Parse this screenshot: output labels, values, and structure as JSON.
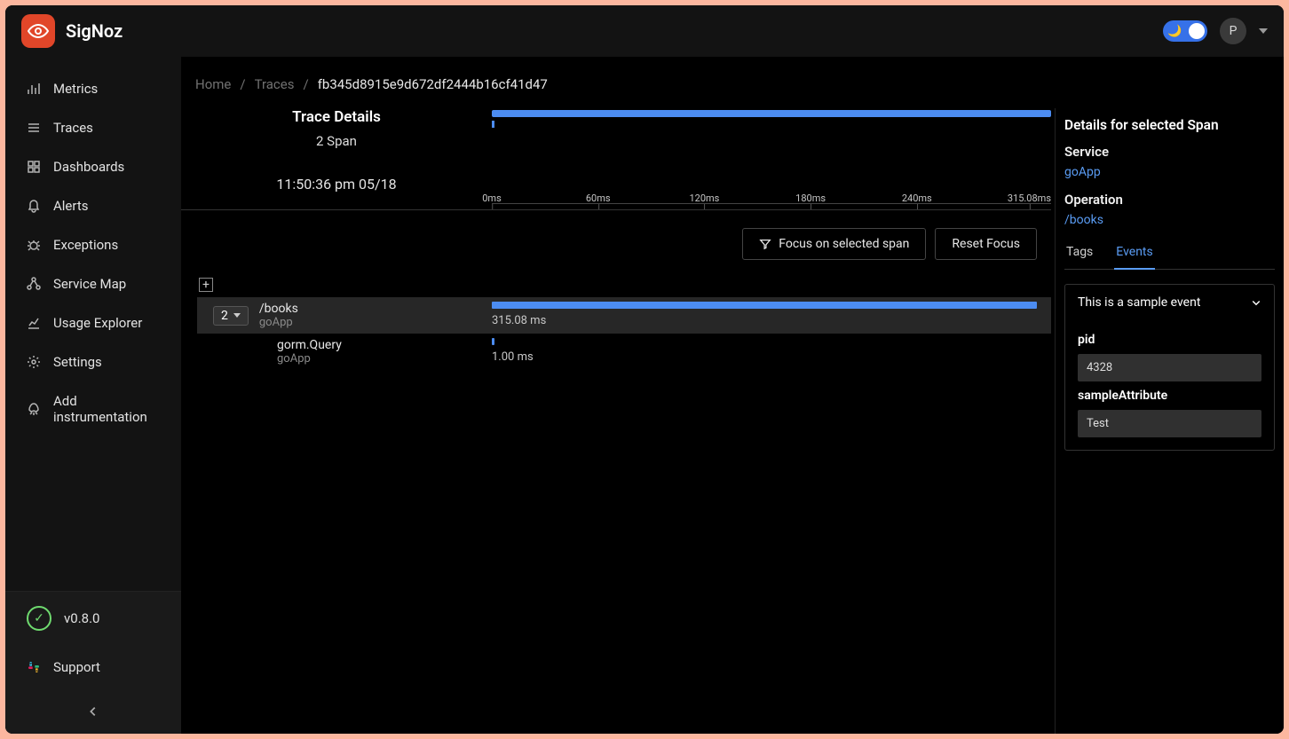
{
  "brand": "SigNoz",
  "avatarInitial": "P",
  "sidebar": {
    "items": [
      "Metrics",
      "Traces",
      "Dashboards",
      "Alerts",
      "Exceptions",
      "Service Map",
      "Usage Explorer",
      "Settings",
      "Add instrumentation"
    ],
    "version": "v0.8.0",
    "support": "Support"
  },
  "breadcrumb": {
    "home": "Home",
    "traces": "Traces",
    "id": "fb345d8915e9d672df2444b16cf41d47"
  },
  "trace": {
    "title": "Trace Details",
    "spanCount": "2 Span",
    "timestamp": "11:50:36 pm 05/18",
    "ticks": [
      "0ms",
      "60ms",
      "120ms",
      "180ms",
      "240ms",
      "315.08ms"
    ],
    "focusBtn": "Focus on selected span",
    "resetBtn": "Reset Focus"
  },
  "spans": {
    "rootCount": "2",
    "root": {
      "op": "/books",
      "svc": "goApp",
      "dur": "315.08 ms"
    },
    "child": {
      "op": "gorm.Query",
      "svc": "goApp",
      "dur": "1.00 ms"
    }
  },
  "details": {
    "title": "Details for selected Span",
    "serviceLabel": "Service",
    "service": "goApp",
    "operationLabel": "Operation",
    "operation": "/books",
    "tabTags": "Tags",
    "tabEvents": "Events",
    "eventTitle": "This is a sample event",
    "attrs": {
      "pidLabel": "pid",
      "pidVal": "4328",
      "sampleLabel": "sampleAttribute",
      "sampleVal": "Test"
    }
  }
}
